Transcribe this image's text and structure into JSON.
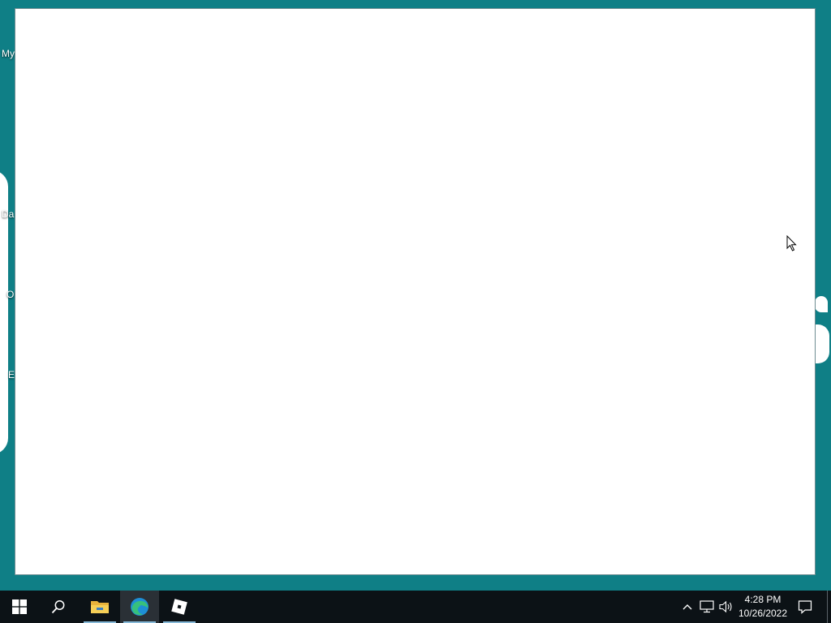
{
  "desktop": {
    "background_color": "#0f7f86",
    "icon_labels_partial": [
      "My",
      "Da",
      "O",
      "E"
    ]
  },
  "window": {
    "content_color": "#ffffff"
  },
  "taskbar": {
    "pinned": [
      {
        "name": "start",
        "icon": "windows-logo-icon"
      },
      {
        "name": "search",
        "icon": "search-icon"
      },
      {
        "name": "file-explorer",
        "icon": "folder-icon"
      },
      {
        "name": "edge",
        "icon": "edge-browser-icon",
        "active": true
      },
      {
        "name": "roblox",
        "icon": "roblox-icon"
      }
    ],
    "tray_icons": [
      "chevron-up-icon",
      "network-icon",
      "volume-icon"
    ],
    "clock": {
      "time": "4:28 PM",
      "date": "10/26/2022"
    },
    "notification_icon": "notification-center-icon"
  }
}
